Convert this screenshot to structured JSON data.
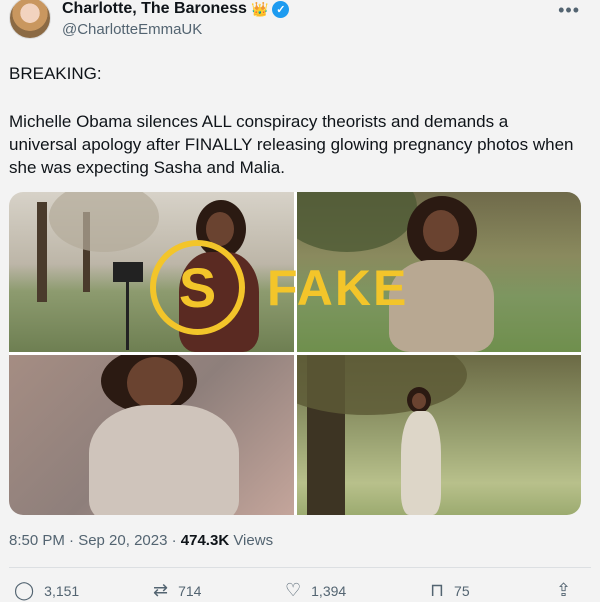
{
  "author": {
    "name": "Charlotte, The Baroness",
    "handle": "@CharlotteEmmaUK"
  },
  "icons": {
    "crown": "👑",
    "verified": "✓",
    "more": "•••",
    "reply": "◯",
    "retweet": "⇄",
    "like": "♡",
    "bookmark": "⊓",
    "share": "⇪"
  },
  "tweet": {
    "lead": "BREAKING:",
    "text": "Michelle Obama silences ALL conspiracy theorists and demands a universal apology after FINALLY releasing glowing pregnancy photos when she was expecting Sasha and Malia."
  },
  "overlay": {
    "logo_letter": "S",
    "word": "FAKE"
  },
  "meta": {
    "time": "8:50 PM · Sep 20, 2023 · ",
    "views": "474.3K",
    "views_label": " Views"
  },
  "stats": {
    "replies": "3,151",
    "retweets": "714",
    "likes": "1,394",
    "bookmarks": "75"
  },
  "colors": {
    "verified_blue": "#1d9bf0",
    "fake_yellow": "#f3c52a"
  }
}
